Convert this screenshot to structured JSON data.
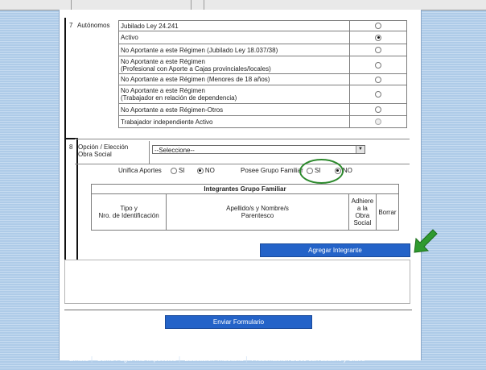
{
  "section7": {
    "number": "7",
    "label": "Autónomos",
    "options": [
      {
        "label": "Jubilado Ley 24.241",
        "selected": false,
        "disabled": false
      },
      {
        "label": "Activo",
        "selected": true,
        "disabled": false
      },
      {
        "label": "No Aportante a este Régimen (Jubilado Ley 18.037/38)",
        "selected": false,
        "disabled": false
      },
      {
        "label1": "No Aportante a este Régimen",
        "label2": "(Profesional con Aporte a Cajas provinciales/locales)",
        "selected": false,
        "disabled": false
      },
      {
        "label": "No Aportante a este Régimen (Menores de 18 años)",
        "selected": false,
        "disabled": false
      },
      {
        "label1": "No Aportante a este Régimen",
        "label2": "(Trabajador en relación de dependencia)",
        "selected": false,
        "disabled": false
      },
      {
        "label": "No Aportante a este Régimen-Otros",
        "selected": false,
        "disabled": false
      },
      {
        "label": "Trabajador independiente Activo",
        "selected": false,
        "disabled": true
      }
    ]
  },
  "section8": {
    "number": "8",
    "label1": "Opción / Elección",
    "label2": "Obra Social",
    "select_value": "--Seleccione--",
    "unifica_label": "Unifica Aportes",
    "si": "SI",
    "no": "NO",
    "posee_label": "Posee Grupo Familiar",
    "unifica_selected": "NO",
    "posee_selected": "NO"
  },
  "family_table": {
    "title": "Integrantes Grupo Familiar",
    "col1_line1": "Tipo y",
    "col1_line2": "Nro. de Identificación",
    "col2_line1": "Apellido/s y Nombre/s",
    "col2_line2": "Parentesco",
    "col3_lines": [
      "Adhiere",
      "a la",
      "Obra",
      "Social"
    ],
    "col4": "Borrar"
  },
  "buttons": {
    "add_member": "Agregar Integrante",
    "submit": "Enviar Formulario"
  },
  "footer_links": [
    "Emails",
    "Cómo Pagar mis Impuestos",
    "Educación Tributaria",
    "Presentacion DDJJ con usuario y Clave"
  ],
  "colors": {
    "button_blue": "#2463c8",
    "highlight_green": "#2d8a2d",
    "page_background": "#aecbe8"
  },
  "icons": {
    "arrow": "green-arrow-icon",
    "dropdown": "chevron-down-icon"
  }
}
